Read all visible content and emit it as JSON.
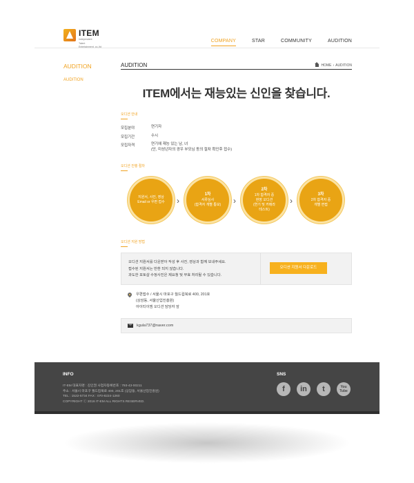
{
  "logo": {
    "title": "ITEM",
    "subtitle_line1": "Independent",
    "subtitle_line2": "Talent",
    "subtitle_line3": "Entertainment. co.,ltd"
  },
  "nav": {
    "items": [
      {
        "label": "COMPANY",
        "active": true
      },
      {
        "label": "STAR",
        "active": false
      },
      {
        "label": "COMMUNITY",
        "active": false
      },
      {
        "label": "AUDITION",
        "active": false
      }
    ]
  },
  "sidebar": {
    "title": "AUDITION",
    "items": [
      {
        "label": "AUDITION"
      }
    ]
  },
  "content": {
    "title": "AUDITION",
    "breadcrumb": {
      "home": "HOME",
      "current": "AUDITION"
    },
    "headline": "ITEM에서는 재능있는 신인을 찾습니다."
  },
  "guide": {
    "label": "오디션 안내",
    "rows": [
      {
        "key": "모집분야",
        "value": "연기자",
        "value2": ""
      },
      {
        "key": "모집기간",
        "value": "수시",
        "value2": ""
      },
      {
        "key": "모집자격",
        "value": "연기에 재능 있는 남, 녀",
        "value2": "(단, 미성년자의 경우 부모님 동의 절차 확인후 접수)"
      }
    ]
  },
  "process": {
    "label": "오디션 진행 절차",
    "steps": [
      {
        "step": "",
        "lines": [
          "지원서, 사진, 영상",
          "Email or 우편 접수"
        ]
      },
      {
        "step": "1차",
        "lines": [
          "서류심사",
          "(합격자 개별 통보)"
        ]
      },
      {
        "step": "2차",
        "lines": [
          "1차 합격자 중",
          "현장 오디션",
          "(연기 및 카메라",
          "테스트)"
        ]
      },
      {
        "step": "3차",
        "lines": [
          "2차 합격자 중",
          "개별 면접"
        ]
      }
    ]
  },
  "apply": {
    "label": "오디션 지원 방법",
    "text_lines": [
      "오디션 지원서를 다운받아 작성 후 사진, 영상과 함께 보내주세요.",
      "접수된 지원서는 반환 되지 않습니다.",
      "과도한 포토샵 수정사진은 제요청 및 무효 처리될 수 있습니다."
    ],
    "download_label": "오디션 지원서 다운로드",
    "post_lines": [
      "우편접수 / 서울시 마포구 월드컵북로 400, 201호",
      "(상암동, 서울산업진흥원)",
      "아이티이엠 오디션 담당자 앞"
    ],
    "email": "kgula737@naver.com"
  },
  "footer": {
    "info_title": "INFO",
    "lines": [
      "IT-EM 대표자명 : 김인권    사업자등록번호 : 793-43-00211",
      "주소 : 서울시 마포구 월드컵북로 400, 201호 (상암동, 서울산업진흥원)",
      "TEL : 1522-5734   FAX : 070-8224-1260",
      "COPYRIGHT ⓒ 2016 IT-EM ALL RIGHTS RESERVED."
    ],
    "sns_title": "SNS",
    "sns": [
      {
        "name": "facebook",
        "glyph": "f"
      },
      {
        "name": "linkedin",
        "glyph": "in"
      },
      {
        "name": "twitter",
        "glyph": "t"
      },
      {
        "name": "youtube",
        "glyph": "You\nTube"
      }
    ]
  },
  "colors": {
    "accent": "#f0a11e",
    "circle": "#e9a414",
    "footer": "#454545"
  }
}
